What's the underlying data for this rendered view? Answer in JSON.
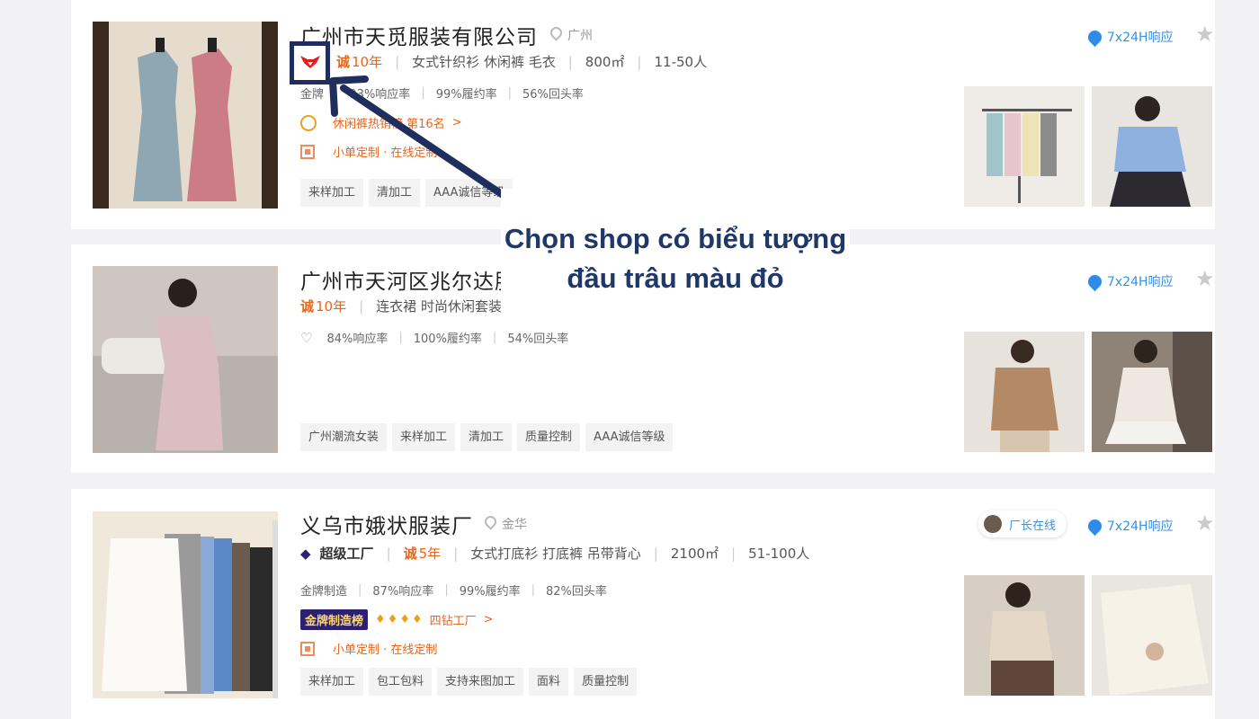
{
  "colors": {
    "accent_orange": "#e8651a",
    "blue_link": "#3a8ee6",
    "annotation_navy": "#1f2e5c",
    "bull_red": "#e02020"
  },
  "cards": [
    {
      "title": "广州市天觅服装有限公司",
      "location": "广州",
      "badge_icon": "red-bull-head-icon",
      "cheng": "诚",
      "years": "10年",
      "categories": "女式针织衫 休闲裤 毛衣",
      "area": "800㎡",
      "staff": "11-50人",
      "metrics": [
        "金牌",
        "93%响应率",
        "99%履约率",
        "56%回头率"
      ],
      "rank_text": "休闲裤热销榜 第16名",
      "rank_suffix": ">",
      "custom_text": "小单定制 · 在线定制",
      "tags": [
        "来样加工",
        "清加工",
        "AAA诚信等级"
      ],
      "response": "7x24H响应"
    },
    {
      "title": "广州市天河区兆尔达服装",
      "cheng": "诚",
      "years": "10年",
      "categories": "连衣裙 时尚休闲套装",
      "metrics": [
        "84%响应率",
        "100%履约率",
        "54%回头率"
      ],
      "tags": [
        "广州潮流女装",
        "来样加工",
        "清加工",
        "质量控制",
        "AAA诚信等级"
      ],
      "response": "7x24H响应"
    },
    {
      "title": "义乌市娥状服装厂",
      "location": "金华",
      "super_factory": "超级工厂",
      "cheng": "诚",
      "years": "5年",
      "categories": "女式打底衫 打底裤 吊带背心",
      "area": "2100㎡",
      "staff": "51-100人",
      "metrics": [
        "金牌制造",
        "87%响应率",
        "99%履约率",
        "82%回头率"
      ],
      "gold_badge": "金牌制造榜",
      "diamond_text": "四钻工厂",
      "diamond_suffix": ">",
      "custom_text": "小单定制 · 在线定制",
      "tags": [
        "来样加工",
        "包工包料",
        "支持来图加工",
        "面料",
        "质量控制"
      ],
      "factory_online": "厂长在线",
      "response": "7x24H响应"
    }
  ],
  "annotation": {
    "callout_text": "Chọn shop có biểu tượng đầu trâu màu đỏ"
  }
}
